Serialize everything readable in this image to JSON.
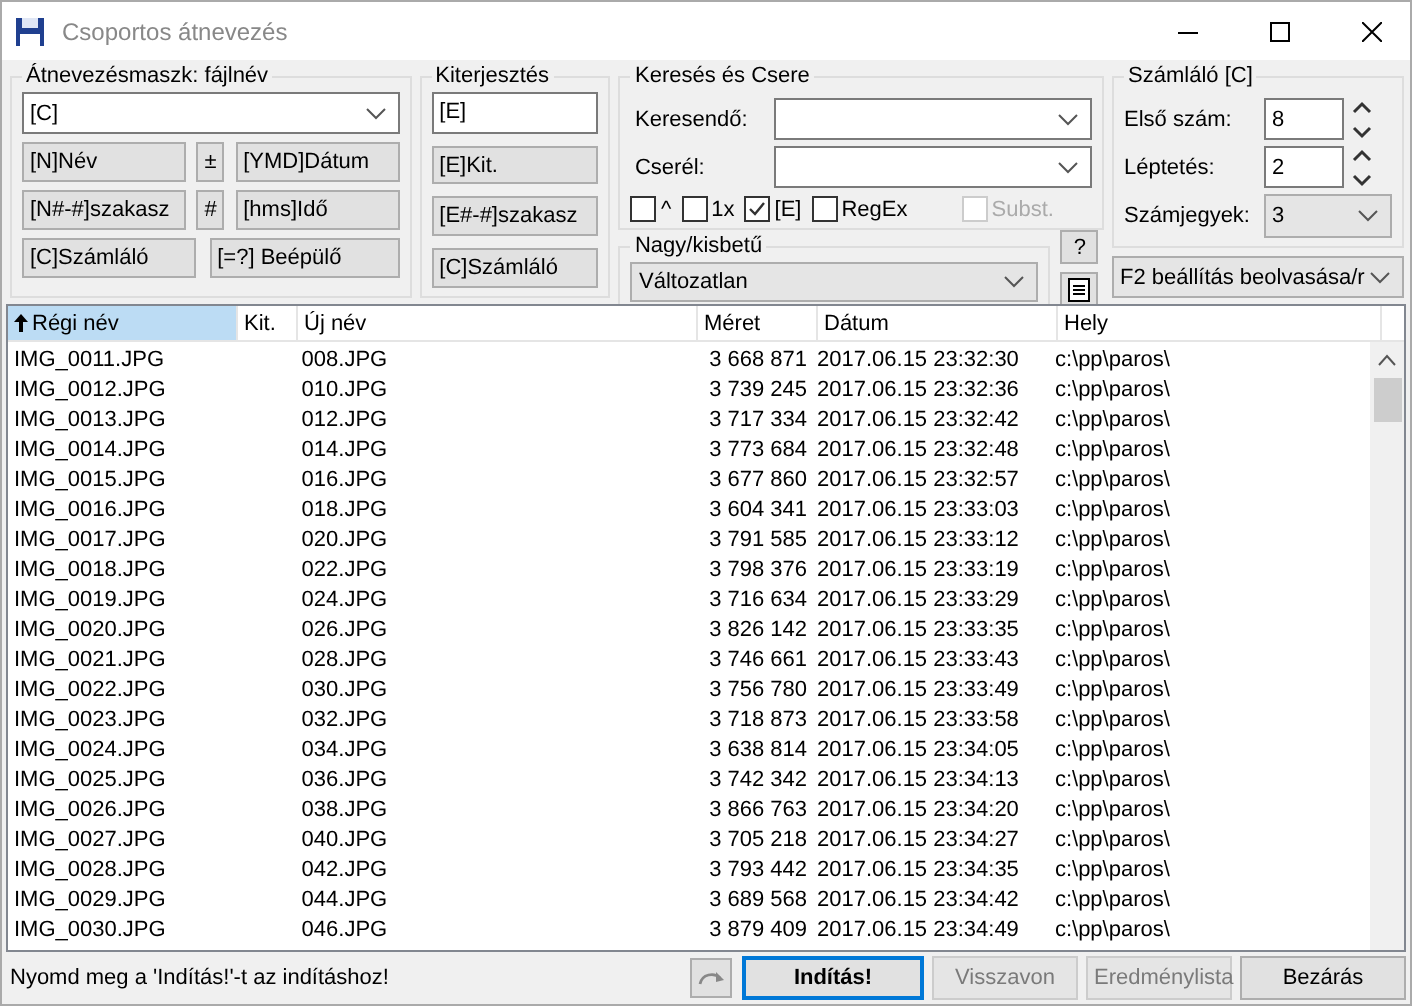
{
  "window": {
    "title": "Csoportos átnevezés"
  },
  "mask": {
    "title": "Átnevezésmaszk: fájlnév",
    "value": "[C]",
    "buttons": [
      {
        "label": "[N]Név",
        "kind": "wide"
      },
      {
        "label": "±",
        "kind": "small"
      },
      {
        "label": "[YMD]Dátum",
        "kind": "wide"
      },
      {
        "label": "[N#-#]szakasz",
        "kind": "wide"
      },
      {
        "label": "#",
        "kind": "small"
      },
      {
        "label": "[hms]Idő",
        "kind": "wide"
      },
      {
        "label": "[C]Számláló",
        "kind": "half"
      },
      {
        "label": "[=?] Beépülő",
        "kind": "half"
      }
    ]
  },
  "extension": {
    "title": "Kiterjesztés",
    "value": "[E]",
    "buttons": [
      "[E]Kit.",
      "[E#-#]szakasz",
      "[C]Számláló"
    ]
  },
  "search": {
    "title": "Keresés és Csere",
    "find_label": "Keresendő:",
    "replace_label": "Cserél:",
    "options": [
      {
        "label": "^",
        "checked": false,
        "disabled": false
      },
      {
        "label": "1x",
        "checked": false,
        "disabled": false
      },
      {
        "label": "[E]",
        "checked": true,
        "disabled": false
      },
      {
        "label": "RegEx",
        "checked": false,
        "disabled": false
      },
      {
        "label": "Subst.",
        "checked": false,
        "disabled": true
      }
    ]
  },
  "case": {
    "title": "Nagy/kisbetű",
    "value": "Változatlan",
    "help": "?"
  },
  "counter": {
    "title": "Számláló [C]",
    "first_label": "Első szám:",
    "first": "8",
    "step_label": "Léptetés:",
    "step": "2",
    "digits_label": "Számjegyek:",
    "digits": "3"
  },
  "settings": {
    "value": "F2 beállítás beolvasása/r"
  },
  "table": {
    "columns": [
      {
        "label": "Régi név",
        "sorted": true
      },
      {
        "label": "Kit.",
        "sorted": false
      },
      {
        "label": "Új név",
        "sorted": false
      },
      {
        "label": "Méret",
        "sorted": false
      },
      {
        "label": "Dátum",
        "sorted": false
      },
      {
        "label": "Hely",
        "sorted": false
      }
    ],
    "rows": [
      [
        "IMG_0011.JPG",
        "",
        "008.JPG",
        "3 668 871",
        "2017.06.15 23:32:30",
        "c:\\pp\\paros\\"
      ],
      [
        "IMG_0012.JPG",
        "",
        "010.JPG",
        "3 739 245",
        "2017.06.15 23:32:36",
        "c:\\pp\\paros\\"
      ],
      [
        "IMG_0013.JPG",
        "",
        "012.JPG",
        "3 717 334",
        "2017.06.15 23:32:42",
        "c:\\pp\\paros\\"
      ],
      [
        "IMG_0014.JPG",
        "",
        "014.JPG",
        "3 773 684",
        "2017.06.15 23:32:48",
        "c:\\pp\\paros\\"
      ],
      [
        "IMG_0015.JPG",
        "",
        "016.JPG",
        "3 677 860",
        "2017.06.15 23:32:57",
        "c:\\pp\\paros\\"
      ],
      [
        "IMG_0016.JPG",
        "",
        "018.JPG",
        "3 604 341",
        "2017.06.15 23:33:03",
        "c:\\pp\\paros\\"
      ],
      [
        "IMG_0017.JPG",
        "",
        "020.JPG",
        "3 791 585",
        "2017.06.15 23:33:12",
        "c:\\pp\\paros\\"
      ],
      [
        "IMG_0018.JPG",
        "",
        "022.JPG",
        "3 798 376",
        "2017.06.15 23:33:19",
        "c:\\pp\\paros\\"
      ],
      [
        "IMG_0019.JPG",
        "",
        "024.JPG",
        "3 716 634",
        "2017.06.15 23:33:29",
        "c:\\pp\\paros\\"
      ],
      [
        "IMG_0020.JPG",
        "",
        "026.JPG",
        "3 826 142",
        "2017.06.15 23:33:35",
        "c:\\pp\\paros\\"
      ],
      [
        "IMG_0021.JPG",
        "",
        "028.JPG",
        "3 746 661",
        "2017.06.15 23:33:43",
        "c:\\pp\\paros\\"
      ],
      [
        "IMG_0022.JPG",
        "",
        "030.JPG",
        "3 756 780",
        "2017.06.15 23:33:49",
        "c:\\pp\\paros\\"
      ],
      [
        "IMG_0023.JPG",
        "",
        "032.JPG",
        "3 718 873",
        "2017.06.15 23:33:58",
        "c:\\pp\\paros\\"
      ],
      [
        "IMG_0024.JPG",
        "",
        "034.JPG",
        "3 638 814",
        "2017.06.15 23:34:05",
        "c:\\pp\\paros\\"
      ],
      [
        "IMG_0025.JPG",
        "",
        "036.JPG",
        "3 742 342",
        "2017.06.15 23:34:13",
        "c:\\pp\\paros\\"
      ],
      [
        "IMG_0026.JPG",
        "",
        "038.JPG",
        "3 866 763",
        "2017.06.15 23:34:20",
        "c:\\pp\\paros\\"
      ],
      [
        "IMG_0027.JPG",
        "",
        "040.JPG",
        "3 705 218",
        "2017.06.15 23:34:27",
        "c:\\pp\\paros\\"
      ],
      [
        "IMG_0028.JPG",
        "",
        "042.JPG",
        "3 793 442",
        "2017.06.15 23:34:35",
        "c:\\pp\\paros\\"
      ],
      [
        "IMG_0029.JPG",
        "",
        "044.JPG",
        "3 689 568",
        "2017.06.15 23:34:42",
        "c:\\pp\\paros\\"
      ],
      [
        "IMG_0030.JPG",
        "",
        "046.JPG",
        "3 879 409",
        "2017.06.15 23:34:49",
        "c:\\pp\\paros\\"
      ]
    ]
  },
  "status": {
    "message": "Nyomd meg a 'Indítás!'-t az indításhoz!",
    "buttons": [
      {
        "label": "Indítás!",
        "kind": "default",
        "disabled": false
      },
      {
        "label": "Visszavon",
        "kind": "normal",
        "disabled": true
      },
      {
        "label": "Eredménylista",
        "kind": "normal",
        "disabled": true
      },
      {
        "label": "Bezárás",
        "kind": "normal",
        "disabled": false
      }
    ]
  }
}
